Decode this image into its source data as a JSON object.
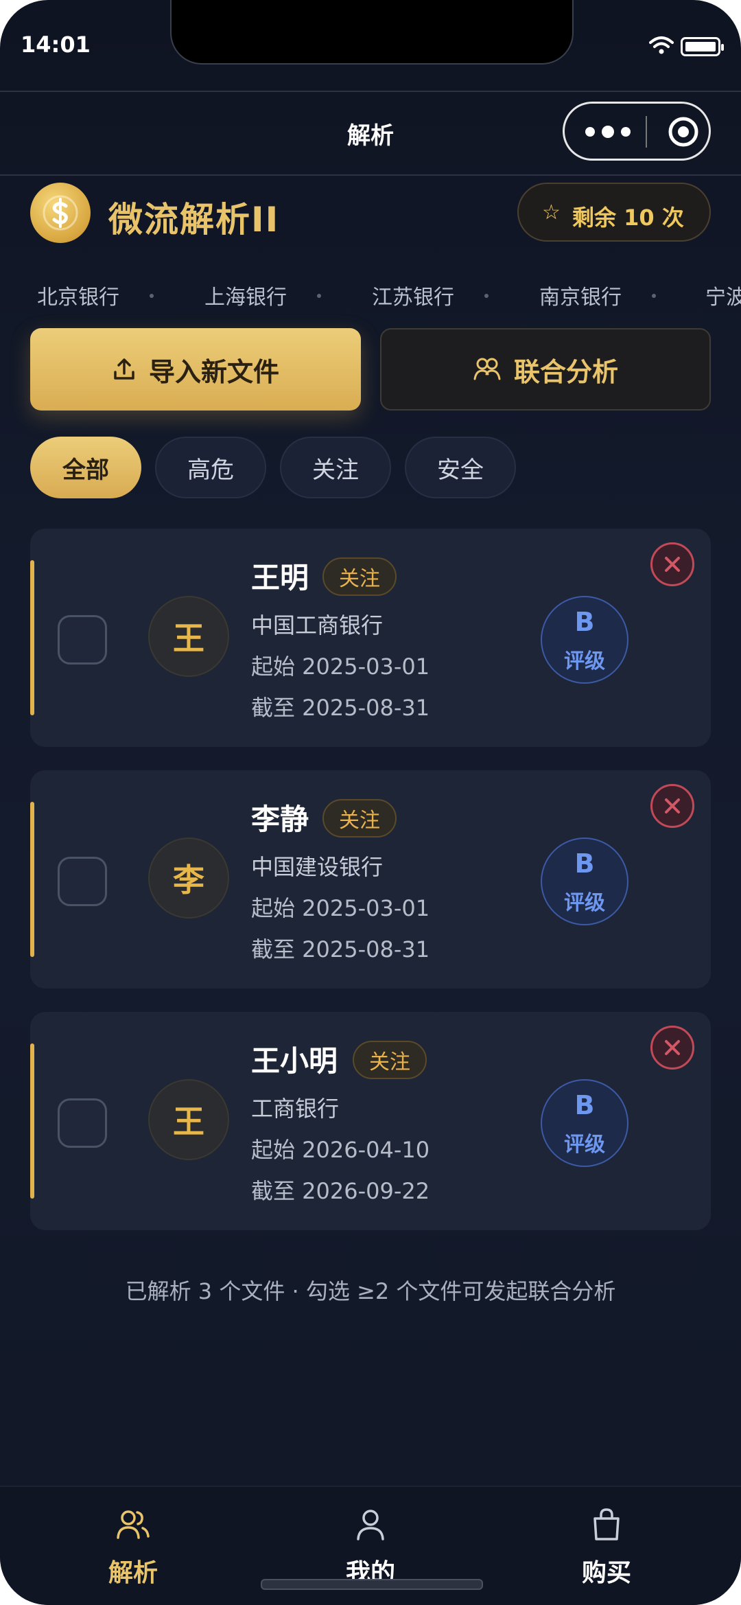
{
  "status": {
    "time": "14:01"
  },
  "nav": {
    "title": "解析"
  },
  "header": {
    "app_title": "微流解析II",
    "quota_label": "剩余 10 次",
    "quota_remaining": 10
  },
  "banks": [
    "北京银行",
    "上海银行",
    "江苏银行",
    "南京银行",
    "宁波"
  ],
  "actions": {
    "import_label": "导入新文件",
    "union_label": "联合分析"
  },
  "filters": [
    "全部",
    "高危",
    "关注",
    "安全"
  ],
  "active_filter": "全部",
  "records": [
    {
      "avatar": "王",
      "name": "王明",
      "tag": "关注",
      "bank": "中国工商银行",
      "start": "起始 2025-03-01",
      "end": "截至 2025-08-31",
      "grade": "B",
      "grade_label": "评级"
    },
    {
      "avatar": "李",
      "name": "李静",
      "tag": "关注",
      "bank": "中国建设银行",
      "start": "起始 2025-03-01",
      "end": "截至 2025-08-31",
      "grade": "B",
      "grade_label": "评级"
    },
    {
      "avatar": "王",
      "name": "王小明",
      "tag": "关注",
      "bank": "工商银行",
      "start": "起始 2026-04-10",
      "end": "截至 2026-09-22",
      "grade": "B",
      "grade_label": "评级"
    }
  ],
  "footer_note": "已解析 3 个文件 · 勾选 ≥2 个文件可发起联合分析",
  "tabbar": [
    {
      "label": "解析",
      "icon": "users-icon",
      "active": true
    },
    {
      "label": "我的",
      "icon": "person-icon",
      "active": false
    },
    {
      "label": "购买",
      "icon": "shopping-bag-icon",
      "active": false
    }
  ],
  "colors": {
    "accent_gold": "#e9c46a",
    "grade_blue": "#6e97f0",
    "danger_red": "#c04a58",
    "background": "#131a2b"
  }
}
